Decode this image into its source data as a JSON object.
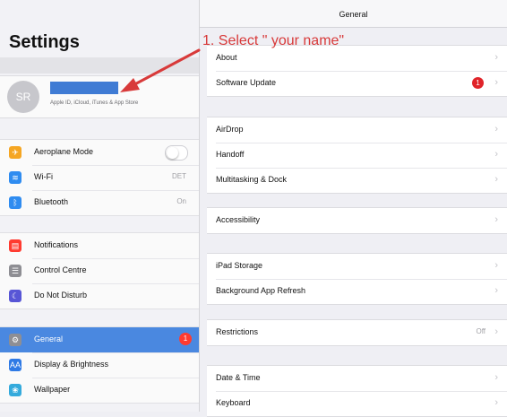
{
  "sidebar": {
    "title": "Settings",
    "profile": {
      "initials": "SR",
      "subtitle": "Apple ID, iCloud, iTunes & App Store"
    },
    "groups": [
      [
        {
          "label": "Aeroplane Mode",
          "icon": "airplane-icon",
          "icon_color": "#f5a623",
          "glyph": "✈",
          "control": "toggle"
        },
        {
          "label": "Wi-Fi",
          "icon": "wifi-icon",
          "icon_color": "#2f8cf0",
          "glyph": "≋",
          "value": "DET"
        },
        {
          "label": "Bluetooth",
          "icon": "bluetooth-icon",
          "icon_color": "#2f8cf0",
          "glyph": "ᛒ",
          "value": "On"
        }
      ],
      [
        {
          "label": "Notifications",
          "icon": "notifications-icon",
          "icon_color": "#ff3b30",
          "glyph": "▤"
        },
        {
          "label": "Control Centre",
          "icon": "control-centre-icon",
          "icon_color": "#8e8e93",
          "glyph": "☰"
        },
        {
          "label": "Do Not Disturb",
          "icon": "moon-icon",
          "icon_color": "#5856d6",
          "glyph": "☾"
        }
      ],
      [
        {
          "label": "General",
          "icon": "gear-icon",
          "icon_color": "#8e8e93",
          "glyph": "⚙",
          "active": true,
          "badge": "1"
        },
        {
          "label": "Display & Brightness",
          "icon": "display-brightness-icon",
          "icon_color": "#2f7ae5",
          "glyph": "AA"
        },
        {
          "label": "Wallpaper",
          "icon": "wallpaper-icon",
          "icon_color": "#34aadc",
          "glyph": "❀"
        }
      ]
    ]
  },
  "main": {
    "header_title": "General",
    "groups": [
      [
        {
          "label": "About"
        },
        {
          "label": "Software Update",
          "badge": "1"
        }
      ],
      [
        {
          "label": "AirDrop"
        },
        {
          "label": "Handoff"
        },
        {
          "label": "Multitasking & Dock"
        }
      ],
      [
        {
          "label": "Accessibility"
        }
      ],
      [
        {
          "label": "iPad Storage"
        },
        {
          "label": "Background App Refresh"
        }
      ],
      [
        {
          "label": "Restrictions",
          "value": "Off"
        }
      ],
      [
        {
          "label": "Date & Time"
        },
        {
          "label": "Keyboard"
        }
      ]
    ]
  },
  "annotation": {
    "text": "1. Select \" your name\"",
    "color": "#d83a3a"
  }
}
